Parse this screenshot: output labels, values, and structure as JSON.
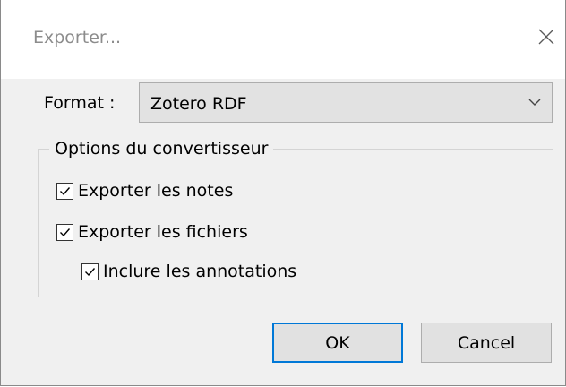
{
  "window": {
    "title": "Exporter...",
    "close_icon": "close-icon"
  },
  "format": {
    "label": "Format :",
    "selected": "Zotero RDF",
    "arrow_icon": "chevron-down-icon"
  },
  "options": {
    "legend": "Options du convertisseur",
    "items": [
      {
        "label": "Exporter les notes",
        "checked": true
      },
      {
        "label": "Exporter les fichiers",
        "checked": true
      },
      {
        "label": "Inclure les annotations",
        "checked": true
      }
    ]
  },
  "buttons": {
    "ok_label": "OK",
    "cancel_label": "Cancel"
  },
  "colors": {
    "accent": "#0078d7",
    "dialog_bg": "#f0f0f0",
    "title_text": "#8c8c8c"
  }
}
